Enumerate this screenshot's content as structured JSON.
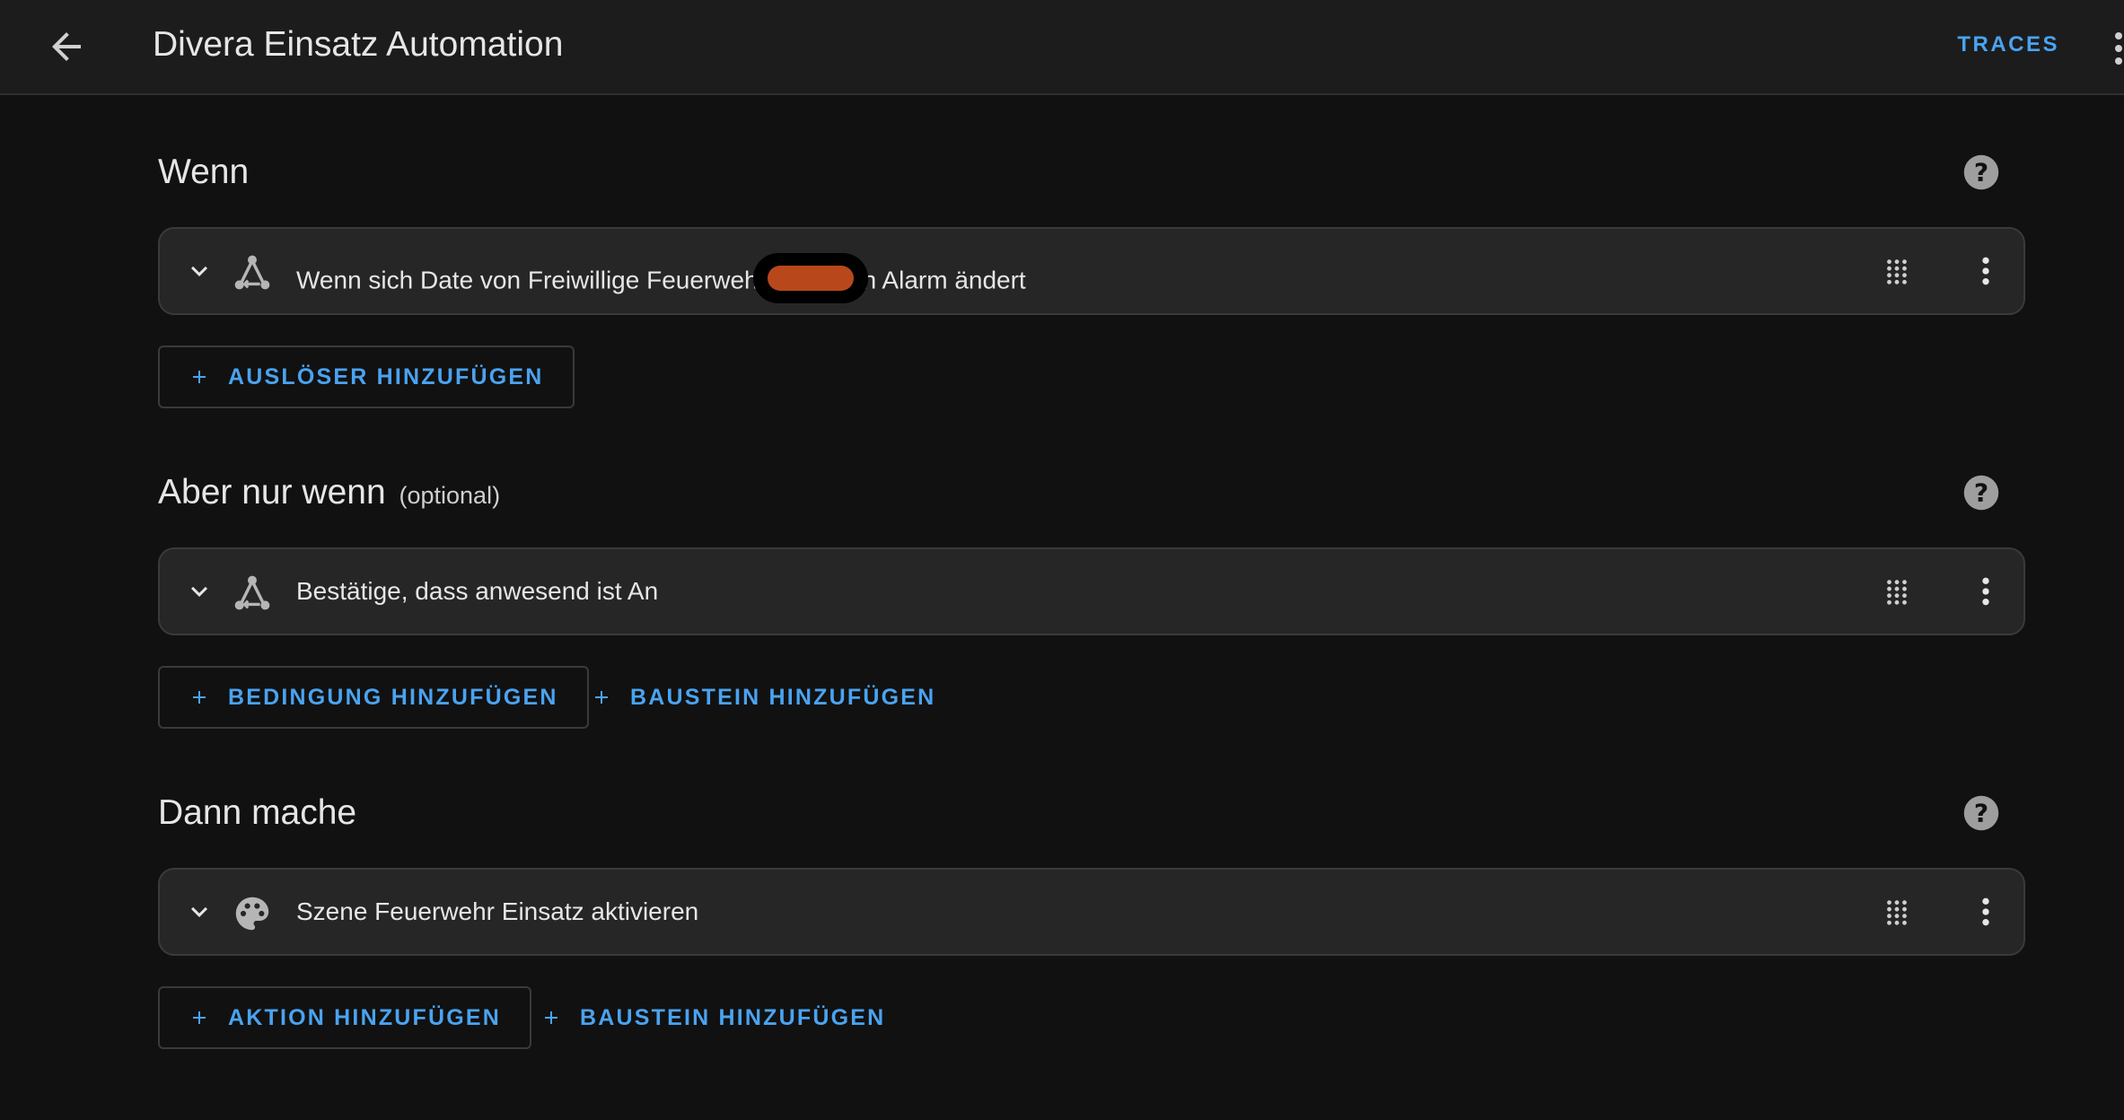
{
  "header": {
    "title": "Divera Einsatz Automation",
    "traces_label": "TRACES"
  },
  "sections": [
    {
      "title": "Wenn",
      "optional": "",
      "item_text_before": "Wenn sich Date von Freiwillige Feuerweh",
      "item_text_after": "h Alarm ändert",
      "item_icon": "graph-nodes-icon",
      "buttons": [
        "AUSLÖSER HINZUFÜGEN"
      ]
    },
    {
      "title": "Aber nur wenn",
      "optional": "(optional)",
      "item_text": "Bestätige, dass anwesend ist An",
      "item_icon": "graph-nodes-icon",
      "buttons": [
        "BEDINGUNG HINZUFÜGEN",
        "BAUSTEIN HINZUFÜGEN"
      ]
    },
    {
      "title": "Dann mache",
      "optional": "",
      "item_text": "Szene Feuerwehr Einsatz aktivieren",
      "item_icon": "palette-icon",
      "buttons": [
        "AKTION HINZUFÜGEN",
        "BAUSTEIN HINZUFÜGEN"
      ]
    }
  ],
  "colors": {
    "background": "#111111",
    "topbar": "#1c1c1c",
    "card": "#262626",
    "accent": "#4aa3f0",
    "redaction": "#b8481b"
  }
}
